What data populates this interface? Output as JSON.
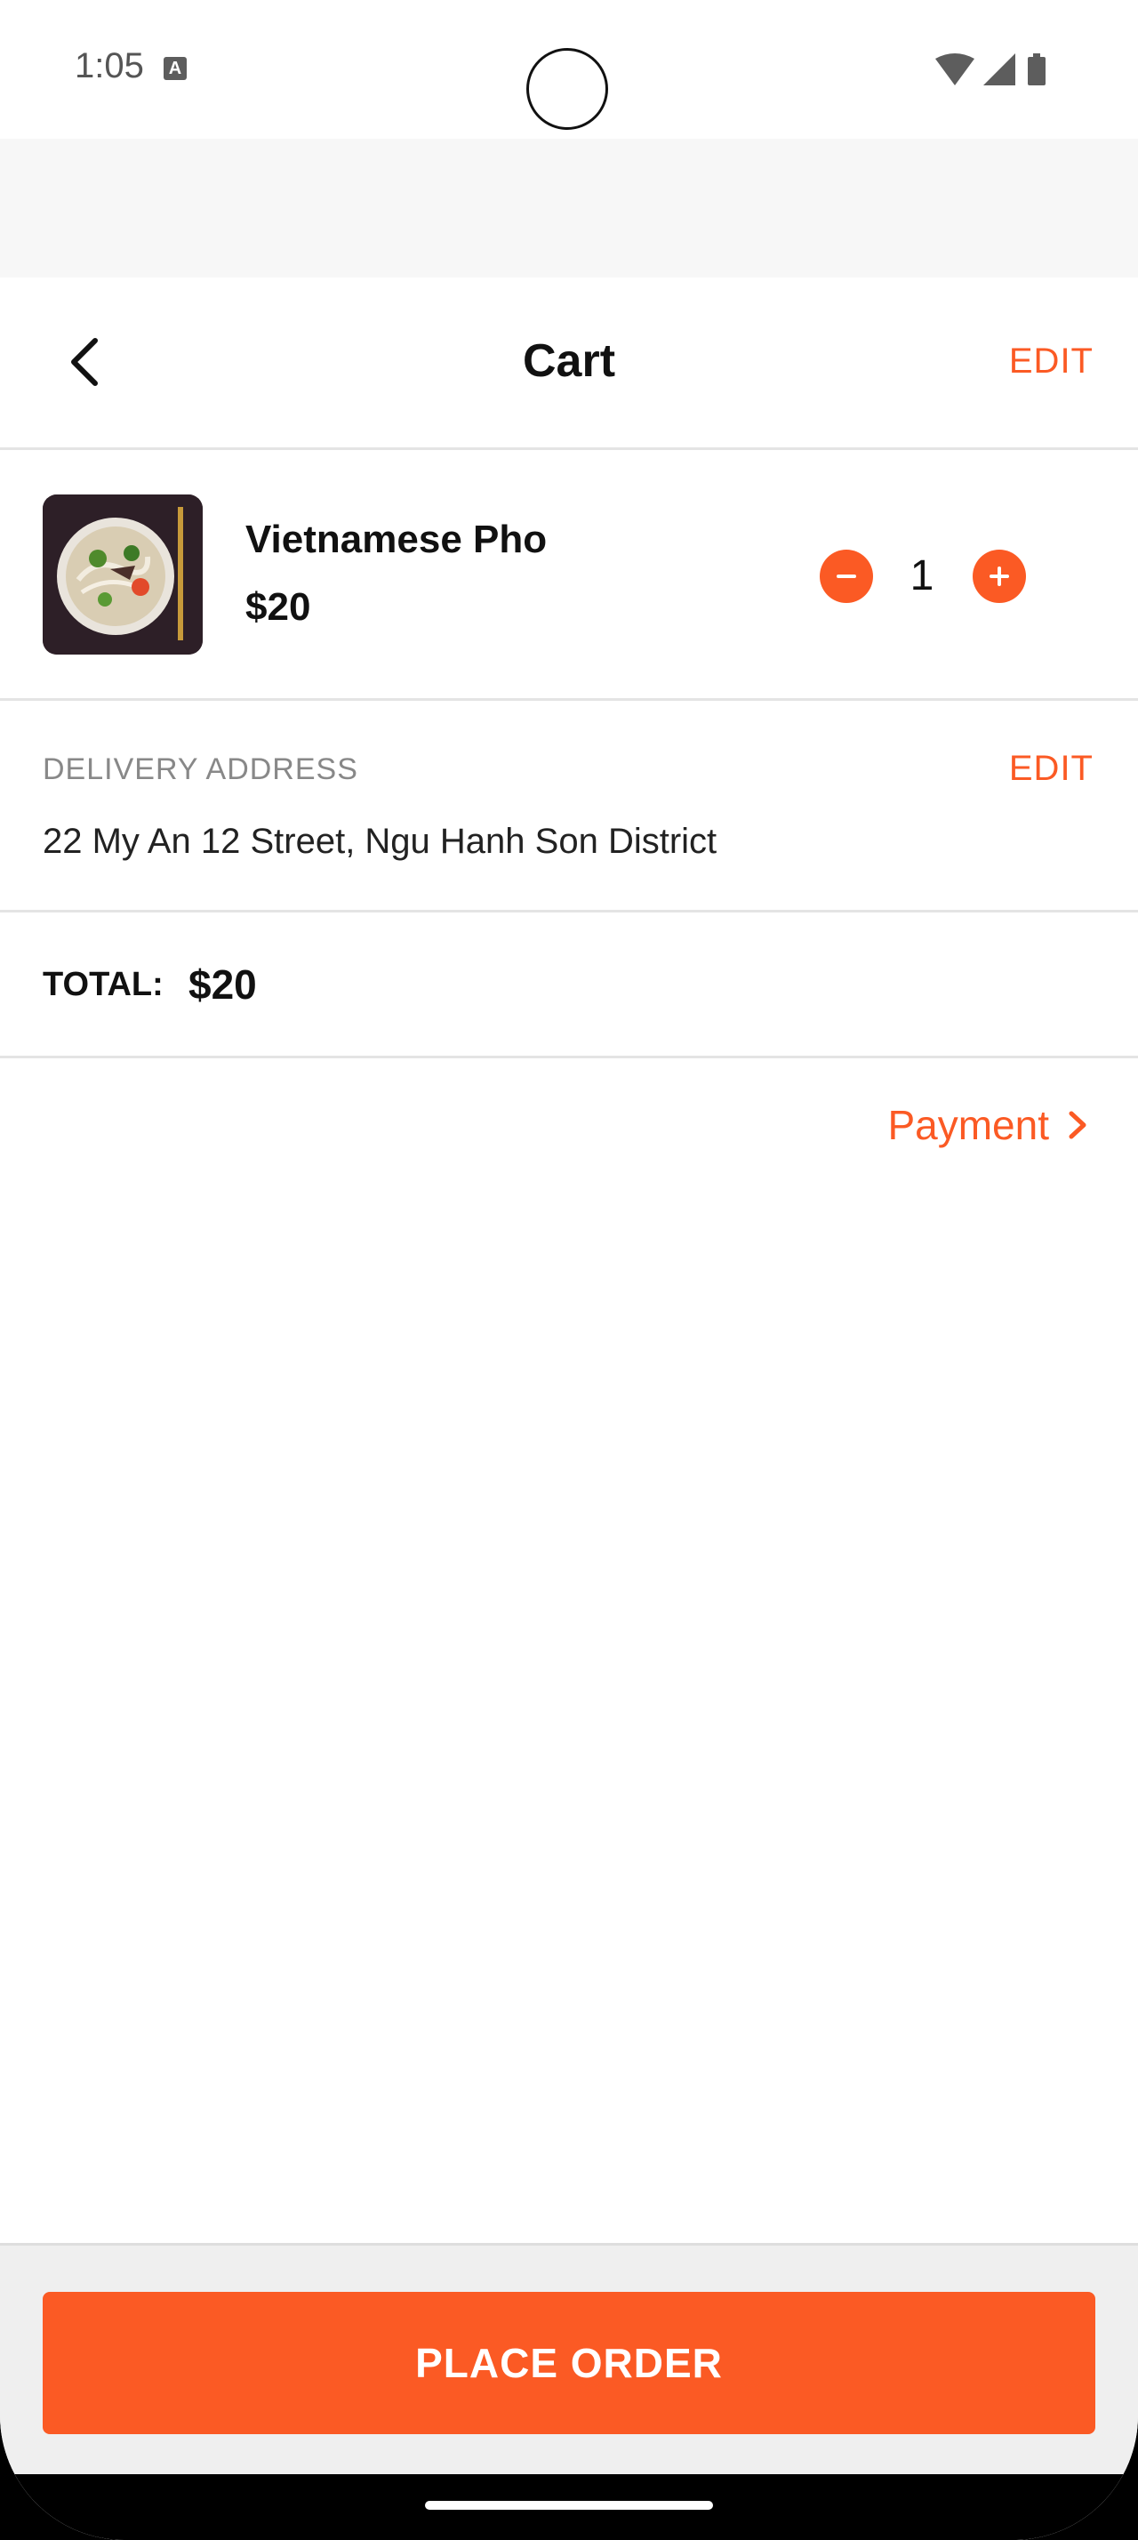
{
  "status_bar": {
    "time": "1:05",
    "notification_icon": "a-letter-icon",
    "icons": [
      "wifi-icon",
      "signal-icon",
      "battery-icon"
    ]
  },
  "header": {
    "back_icon": "chevron-left-icon",
    "title": "Cart",
    "edit_label": "EDIT"
  },
  "cart_item": {
    "name": "Vietnamese Pho",
    "price": "$20",
    "quantity": "1",
    "thumbnail": "pho-bowl-image"
  },
  "delivery": {
    "label": "DELIVERY ADDRESS",
    "edit_label": "EDIT",
    "address": "22 My An 12 Street, Ngu Hanh Son District"
  },
  "total": {
    "label": "TOTAL:",
    "value": "$20"
  },
  "payment": {
    "label": "Payment",
    "icon": "chevron-right-icon"
  },
  "footer": {
    "place_order_label": "PLACE ORDER"
  },
  "colors": {
    "accent": "#fb5a24",
    "text": "#111111",
    "muted": "#888888",
    "divider": "#e4e4e4"
  }
}
